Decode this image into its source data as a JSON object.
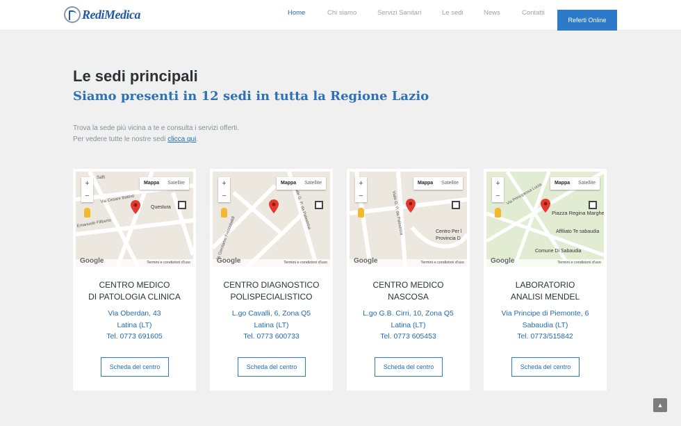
{
  "header": {
    "logo": "RediMedica",
    "nav": [
      {
        "label": "Home",
        "active": true
      },
      {
        "label": "Chi siamo",
        "active": false
      },
      {
        "label": "Servizi Sanitari",
        "active": false
      },
      {
        "label": "Le sedi",
        "active": false
      },
      {
        "label": "News",
        "active": false
      },
      {
        "label": "Contatti",
        "active": false
      }
    ],
    "cta": "Referti Online"
  },
  "page": {
    "title": "Le sedi principali",
    "subtitle": "Siamo presenti in 12 sedi in tutta la Regione Lazio",
    "intro_line1": "Trova la sede più vicina a te e consulta i servizi offerti.",
    "intro_line2_prefix": "Per vedere tutte le nostre sedi ",
    "intro_link": "clicca qui",
    "intro_line2_suffix": "."
  },
  "map_common": {
    "tab_map": "Mappa",
    "tab_satellite": "Satellite",
    "zoom_in": "+",
    "zoom_out": "−",
    "google": "Google",
    "terms": "Termini e condizioni d'uso"
  },
  "cards": [
    {
      "name_line1": "CENTRO MEDICO",
      "name_line2": "DI PATOLOGIA CLINICA",
      "address": "Via Oberdan, 43",
      "city": "Latina (LT)",
      "phone": "Tel. 0773 691605",
      "button": "Scheda del centro",
      "map_labels": [
        "Via Cesare Battisti",
        "Questura",
        "Emanuele Filiberto",
        "Saffi"
      ]
    },
    {
      "name_line1": "CENTRO DIAGNOSTICO",
      "name_line2": "POLISPECIALISTICO",
      "address": "L.go Cavalli, 6, Zona Q5",
      "city": "Latina (LT)",
      "phone": "Tel. 0773 600733",
      "button": "Scheda del centro",
      "map_labels": [
        "Viale G. P. da Palestrina",
        "Via Gerolamo Frescobaldi"
      ]
    },
    {
      "name_line1": "CENTRO MEDICO",
      "name_line2": "NASCOSA",
      "address": "L.go G.B. Cirri, 10, Zona Q5",
      "city": "Latina (LT)",
      "phone": "Tel. 0773 605453",
      "button": "Scheda del centro",
      "map_labels": [
        "Viale G. P. da Palestrina",
        "Centro Per l",
        "Provincia D"
      ]
    },
    {
      "name_line1": "LABORATORIO",
      "name_line2": "ANALISI MENDEL",
      "address": "Via Principe di Piemonte, 6",
      "city": "Sabaudia (LT)",
      "phone": "Tel. 0773/515842",
      "button": "Scheda del centro",
      "map_labels": [
        "Via Principessa Lucia",
        "Piazza Regina Margherita",
        "Affiliato Te sabaudia",
        "Comune Di Sabaudia"
      ]
    }
  ],
  "scroll_top": "▲"
}
